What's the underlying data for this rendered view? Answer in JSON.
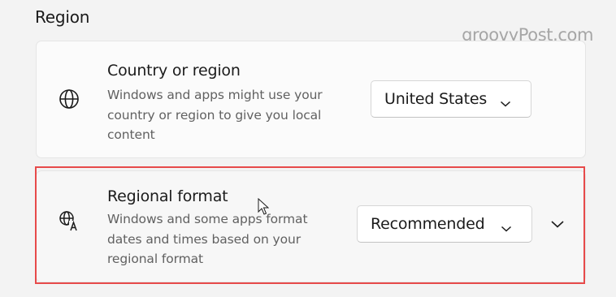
{
  "section": {
    "title": "Region"
  },
  "watermark": {
    "text": "groovyPost.com"
  },
  "country_row": {
    "icon": "globe-icon",
    "title": "Country or region",
    "description": "Windows and apps might use your country or region to give you local content",
    "dropdown_value": "United States"
  },
  "regional_row": {
    "icon": "language-format-icon",
    "title": "Regional format",
    "description": "Windows and some apps format dates and times based on your regional format",
    "dropdown_value": "Recommended",
    "highlight_color": "#e74a4a"
  }
}
